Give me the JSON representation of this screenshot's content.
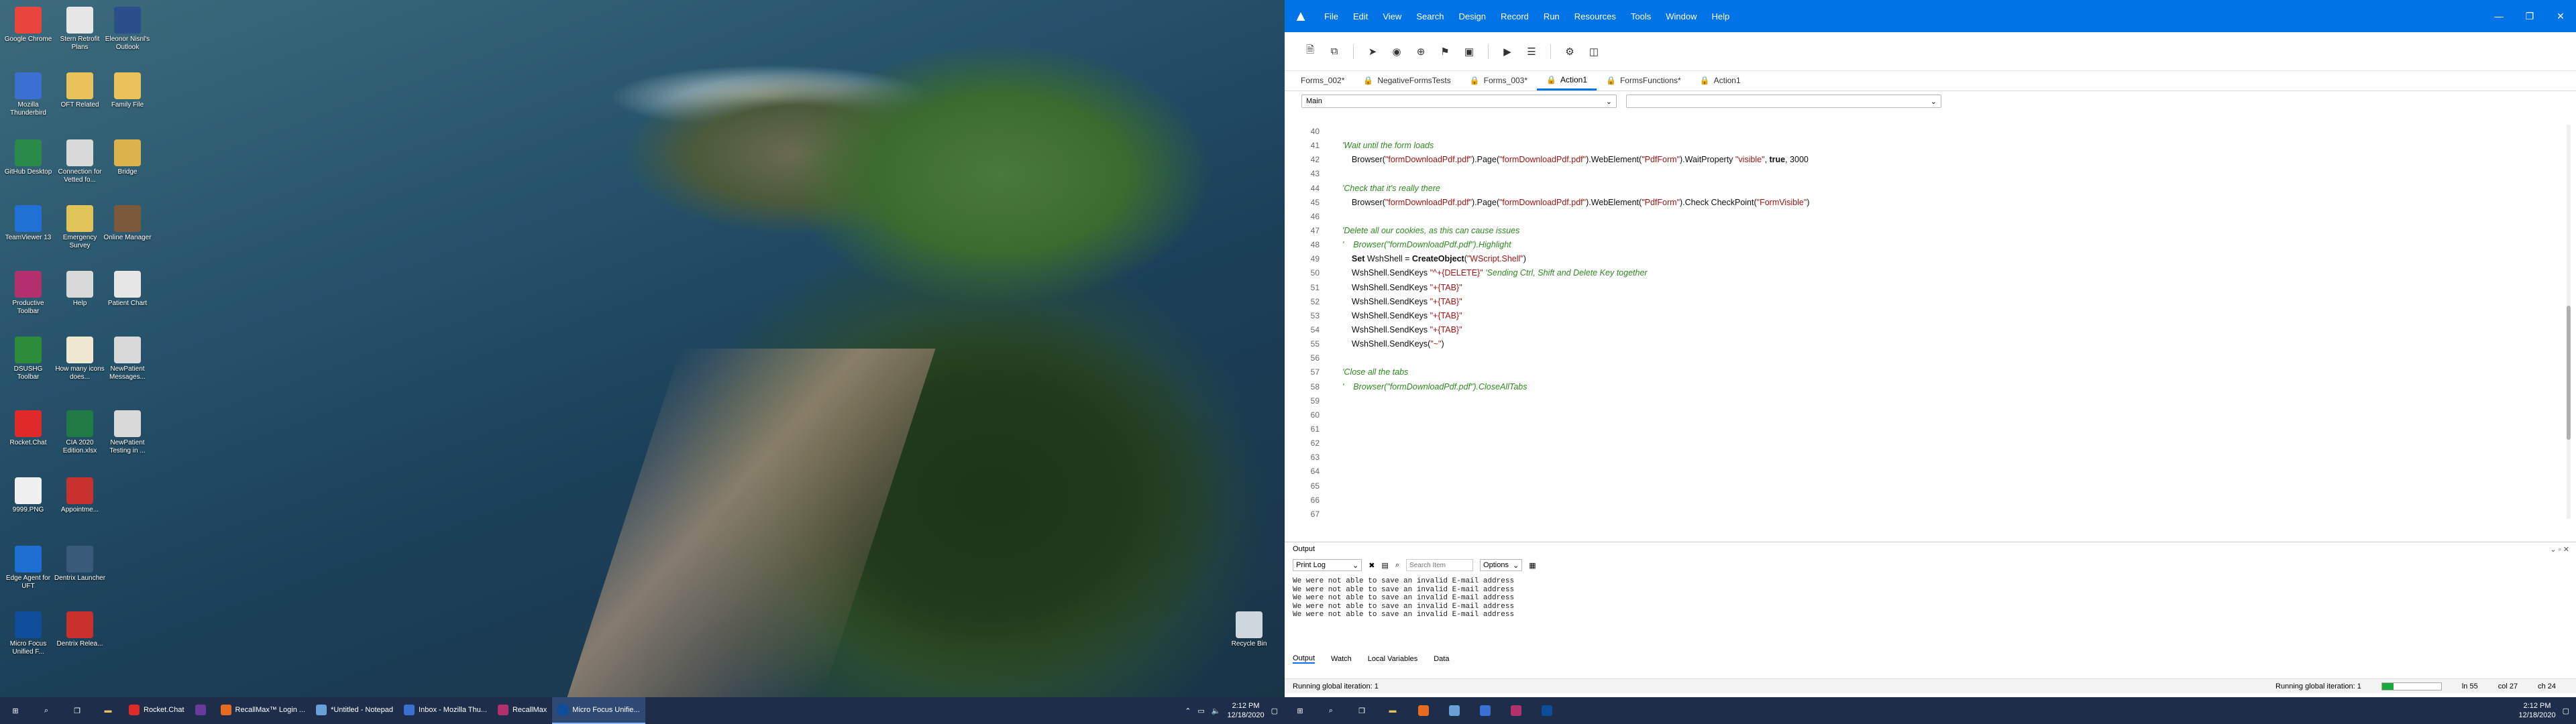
{
  "desktop": {
    "icons": [
      {
        "label": "Google Chrome",
        "icon": "chrome-icon",
        "color": "#e8453c"
      },
      {
        "label": "Stern Retrofit Plans",
        "icon": "document-icon",
        "color": "#e6e6e6"
      },
      {
        "label": "Eleonor Nisnl's Outlook",
        "icon": "x-icon",
        "color": "#2a4f8a"
      },
      {
        "label": "Mozilla Thunderbird",
        "icon": "thunderbird-icon",
        "color": "#3b6fd1"
      },
      {
        "label": "OFT Related",
        "icon": "folder-icon",
        "color": "#e8c35c"
      },
      {
        "label": "Family File",
        "icon": "folder-icon",
        "color": "#e8c35c"
      },
      {
        "label": "GitHub Desktop",
        "icon": "github-icon",
        "color": "#2a8a4a"
      },
      {
        "label": "Connection for Vetted fo...",
        "icon": "document-icon",
        "color": "#d9d9d9"
      },
      {
        "label": "Bridge",
        "icon": "bridge-icon",
        "color": "#d8b44a"
      },
      {
        "label": "TeamViewer 13",
        "icon": "teamviewer-icon",
        "color": "#1f72d3"
      },
      {
        "label": "Emergency Survey",
        "icon": "document-icon",
        "color": "#e0c45a"
      },
      {
        "label": "Online Manager",
        "icon": "manager-icon",
        "color": "#7a5a3a"
      },
      {
        "label": "Productive Toolbar",
        "icon": "toolbar-icon",
        "color": "#b3306e"
      },
      {
        "label": "Help",
        "icon": "help-icon",
        "color": "#d9d9d9"
      },
      {
        "label": "Patient Chart",
        "icon": "chart-icon",
        "color": "#e6e6e6"
      },
      {
        "label": "DSUSHG Toolbar",
        "icon": "toolbar-icon",
        "color": "#2e8b3a"
      },
      {
        "label": "How many icons does...",
        "icon": "document-icon",
        "color": "#efe8d0"
      },
      {
        "label": "NewPatient Messages...",
        "icon": "document-icon",
        "color": "#d9d9d9"
      },
      {
        "label": "Rocket.Chat",
        "icon": "rocketchat-icon",
        "color": "#e02a2a"
      },
      {
        "label": "CIA 2020 Edition.xlsx",
        "icon": "excel-icon",
        "color": "#1f7a44"
      },
      {
        "label": "NewPatient Testing in ...",
        "icon": "document-icon",
        "color": "#d9d9d9"
      },
      {
        "label": "9999.PNG",
        "icon": "image-icon",
        "color": "#f0f0f0"
      },
      {
        "label": "Appointme...",
        "icon": "appointment-icon",
        "color": "#c8322e"
      },
      {
        "label": "Edge Agent for UFT",
        "icon": "edge-icon",
        "color": "#1f6fd3"
      },
      {
        "label": "Dentrix Launcher",
        "icon": "dentrix-icon",
        "color": "#3a5a7a"
      },
      {
        "label": "Micro Focus Unified F...",
        "icon": "microfocus-icon",
        "color": "#0f4c9a"
      },
      {
        "label": "Dentrix Relea...",
        "icon": "dentrix-icon",
        "color": "#c9302c"
      },
      {
        "label": "Recycle Bin",
        "icon": "recycle-bin-icon",
        "color": "#cfd8dc"
      }
    ]
  },
  "left_taskbar": {
    "apps": [
      {
        "label": "Rocket.Chat",
        "icon": "rocketchat-icon",
        "color": "#e02a2a",
        "active": false
      },
      {
        "label": "",
        "icon": "app-icon",
        "color": "#6a3a9a",
        "active": false
      },
      {
        "label": "RecallMax™ Login ...",
        "icon": "firefox-icon",
        "color": "#e66a1f",
        "active": false
      },
      {
        "label": "*Untitled - Notepad",
        "icon": "notepad-icon",
        "color": "#6aa0d8",
        "active": false
      },
      {
        "label": "Inbox - Mozilla Thu...",
        "icon": "thunderbird-icon",
        "color": "#3b6fd1",
        "active": false
      },
      {
        "label": "RecallMax",
        "icon": "recallmax-icon",
        "color": "#b3306e",
        "active": false
      },
      {
        "label": "Micro Focus Unifie...",
        "icon": "microfocus-icon",
        "color": "#0f4c9a",
        "active": true
      }
    ],
    "time": "2:12 PM",
    "date": "12/18/2020"
  },
  "app": {
    "menu": [
      "File",
      "Edit",
      "View",
      "Search",
      "Design",
      "Record",
      "Run",
      "Resources",
      "Tools",
      "Window",
      "Help"
    ],
    "tabs": [
      {
        "label": "Forms_002*",
        "locked": false,
        "active": false
      },
      {
        "label": "NegativeFormsTests",
        "locked": true,
        "active": false
      },
      {
        "label": "Forms_003*",
        "locked": true,
        "active": false
      },
      {
        "label": "Action1",
        "locked": true,
        "active": true
      },
      {
        "label": "FormsFunctions*",
        "locked": true,
        "active": false
      },
      {
        "label": "Action1",
        "locked": true,
        "active": false
      }
    ],
    "selector_left": "Main",
    "selector_right": "",
    "line_numbers": [
      "40",
      "41",
      "42",
      "43",
      "44",
      "45",
      "46",
      "47",
      "48",
      "49",
      "50",
      "51",
      "52",
      "53",
      "54",
      "55",
      "56",
      "57",
      "58",
      "59",
      "60",
      "61",
      "62",
      "63",
      "64",
      "65",
      "66",
      "67"
    ],
    "code_lines": [
      "",
      "'Wait until the form loads",
      "    Browser(\"formDownloadPdf.pdf\").Page(\"formDownloadPdf.pdf\").WebElement(\"PdfForm\").WaitProperty \"visible\", true, 3000",
      "",
      "'Check that it's really there",
      "    Browser(\"formDownloadPdf.pdf\").Page(\"formDownloadPdf.pdf\").WebElement(\"PdfForm\").Check CheckPoint(\"FormVisible\")",
      "",
      "'Delete all our cookies, as this can cause issues",
      "'    Browser(\"formDownloadPdf.pdf\").Highlight",
      "    Set WshShell = CreateObject(\"WScript.Shell\")",
      "    WshShell.SendKeys \"^+{DELETE}\" 'Sending Ctrl, Shift and Delete Key together",
      "    WshShell.SendKeys \"+{TAB}\"",
      "    WshShell.SendKeys \"+{TAB}\"",
      "    WshShell.SendKeys \"+{TAB}\"",
      "    WshShell.SendKeys \"+{TAB}\"",
      "    WshShell.SendKeys(\"~\")",
      "",
      "'Close all the tabs",
      "'    Browser(\"formDownloadPdf.pdf\").CloseAllTabs",
      "",
      "",
      "",
      "",
      "",
      "",
      "",
      "",
      ""
    ],
    "output": {
      "title": "Output",
      "log_source": "Print Log",
      "search_placeholder": "Search Item",
      "options_label": "Options",
      "lines": [
        "We were not able to save an invalid E-mail address",
        "We were not able to save an invalid E-mail address",
        "We were not able to save an invalid E-mail address",
        "We were not able to save an invalid E-mail address",
        "We were not able to save an invalid E-mail address"
      ],
      "tabs": [
        "Output",
        "Watch",
        "Local Variables",
        "Data"
      ]
    },
    "status": {
      "left": "Running global iteration: 1",
      "right": "Running global iteration: 1",
      "progress": 0.2,
      "ln": "ln 55",
      "col": "col 27",
      "ch": "ch 24"
    }
  },
  "right_taskbar": {
    "apps": [
      {
        "icon": "firefox-icon",
        "color": "#e66a1f"
      },
      {
        "icon": "notepad-icon",
        "color": "#6aa0d8"
      },
      {
        "icon": "thunderbird-icon",
        "color": "#3b6fd1"
      },
      {
        "icon": "recallmax-icon",
        "color": "#b3306e"
      },
      {
        "icon": "microfocus-icon",
        "color": "#0f4c9a"
      }
    ],
    "time": "2:12 PM",
    "date": "12/18/2020"
  },
  "colors": {
    "accent": "#0073e7",
    "taskbar": "#1d2d4a",
    "comment": "#2e8b1e",
    "string": "#a31515"
  }
}
